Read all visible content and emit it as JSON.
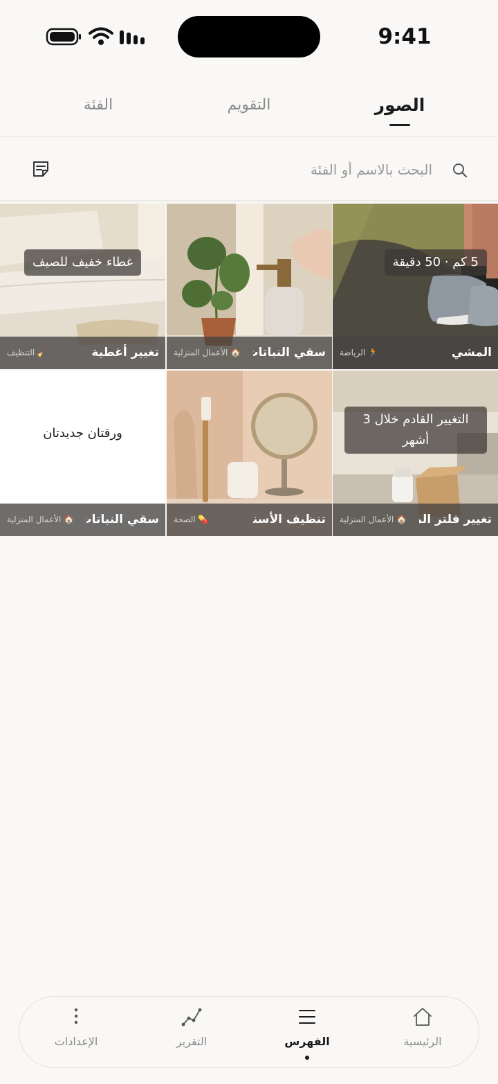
{
  "status_bar": {
    "time": "9:41"
  },
  "tabs": [
    {
      "label": "الصور",
      "active": true
    },
    {
      "label": "التقويم",
      "active": false
    },
    {
      "label": "الفئة",
      "active": false
    }
  ],
  "search": {
    "placeholder": "البحث بالاسم أو الفئة",
    "value": ""
  },
  "grid": {
    "items": [
      {
        "title": "المشي",
        "category": "🏃 الرياضة",
        "note": "5 كم · 50 دقيقة",
        "photo": "sneakers-on-path"
      },
      {
        "title": "سقي النباتات",
        "category": "🏠 الأعمال المنزلية",
        "note": "",
        "photo": "plant-and-spray-bottle"
      },
      {
        "title": "تغيير أغطية السرير",
        "category": "🧹 التنظيف",
        "note": "غطاء خفيف للصيف",
        "photo": "bed-linens"
      },
      {
        "title": "تغيير فلتر الماء",
        "category": "🏠 الأعمال المنزلية",
        "note": "التغيير القادم خلال 3 أشهر",
        "photo": "water-filter-box"
      },
      {
        "title": "تنظيف الأسنان",
        "category": "💊 الصحة",
        "note": "",
        "photo": "toothbrush-and-mirror"
      },
      {
        "title": "سقي النباتات",
        "category": "🏠 الأعمال المنزلية",
        "note": "ورقتان جديدتان",
        "photo": "none"
      }
    ]
  },
  "bottom_nav": {
    "items": [
      {
        "label": "الرئيسية",
        "icon": "home-icon",
        "active": false
      },
      {
        "label": "الفهرس",
        "icon": "menu-icon",
        "active": true
      },
      {
        "label": "التقرير",
        "icon": "chart-line-icon",
        "active": false
      },
      {
        "label": "الإعدادات",
        "icon": "more-vertical-icon",
        "active": false
      }
    ]
  }
}
